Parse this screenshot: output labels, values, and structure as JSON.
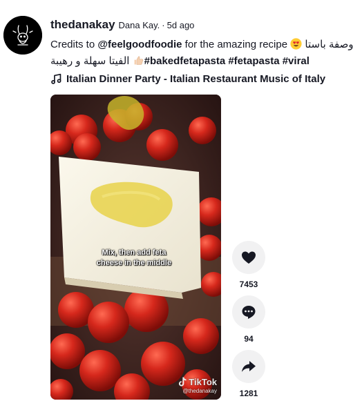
{
  "post": {
    "username": "thedanakay",
    "nickname": "Dana Kay.",
    "separator": "·",
    "age": "5d ago",
    "caption": {
      "prefix": "Credits to ",
      "mention": "@feelgoodfoodie",
      "middle": " for the amazing recipe ",
      "emoji_heart_eyes": "😍",
      "arabic_1": "وصفة باستا",
      "arabic_2": "الفيتا سهلة و رهيبة",
      "emoji_thumbs_up": "👍🏻",
      "tags": [
        "#bakedfetapasta",
        "#fetapasta",
        "#viral"
      ]
    },
    "music": {
      "icon": "music-note-icon",
      "title": "Italian Dinner Party - Italian Restaurant Music of Italy"
    }
  },
  "video": {
    "subtitle_line1": "Mix, then add feta",
    "subtitle_line2": "cheese in the middle",
    "watermark_brand": "TikTok",
    "watermark_handle": "@thedanakay"
  },
  "actions": {
    "like": {
      "icon": "heart-icon",
      "count": "7453"
    },
    "comment": {
      "icon": "comment-icon",
      "count": "94"
    },
    "share": {
      "icon": "share-icon",
      "count": "1281"
    }
  },
  "colors": {
    "text": "#161823",
    "action_bg": "#f1f1f2",
    "tomato": "#c8261c"
  }
}
